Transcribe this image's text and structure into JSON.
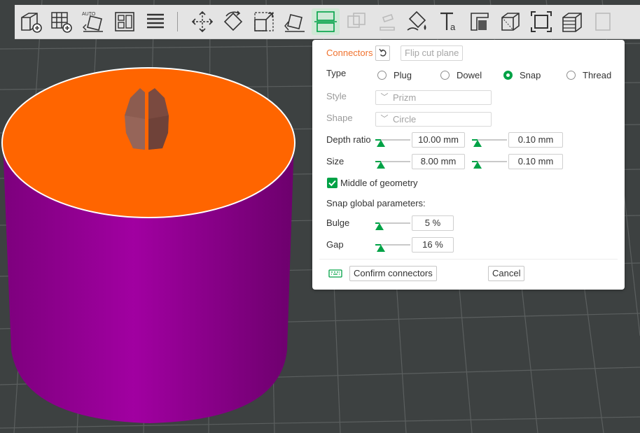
{
  "colors": {
    "accent": "#f0722e",
    "green": "#00a246",
    "background": "#3d4141",
    "cylinder_top": "#ff6500",
    "cylinder_side": "#8a008a",
    "connector": "#8a5a4e"
  },
  "toolbar": {
    "icons": [
      "add-object-icon",
      "add-plate-icon",
      "auto-orient-icon",
      "arrange-icon",
      "split-objects-icon",
      "move-icon",
      "rotate-icon",
      "scale-icon",
      "lay-on-face-icon",
      "cut-icon",
      "boolean-icon",
      "support-painting-icon",
      "seam-painting-icon",
      "color-painting-icon",
      "text-icon",
      "measure-icon",
      "assembly-icon",
      "brim-ears-icon",
      "variable-layer-icon",
      "more-icon"
    ]
  },
  "panel": {
    "connectors_label": "Connectors",
    "flip_label": "Flip cut plane",
    "type_label": "Type",
    "type_options": [
      "Plug",
      "Dowel",
      "Snap",
      "Thread"
    ],
    "type_selected": "Snap",
    "style_label": "Style",
    "style_value": "Prizm",
    "shape_label": "Shape",
    "shape_value": "Circle",
    "depth_label": "Depth ratio",
    "depth_value": "10.00  mm",
    "depth_tol": "0.10  mm",
    "size_label": "Size",
    "size_value": "8.00  mm",
    "size_tol": "0.10  mm",
    "middle_label": "Middle of geometry",
    "middle_checked": true,
    "snap_global_label": "Snap global parameters:",
    "bulge_label": "Bulge",
    "bulge_value": "5 %",
    "gap_label": "Gap",
    "gap_value": "16 %",
    "confirm_label": "Confirm connectors",
    "cancel_label": "Cancel"
  }
}
